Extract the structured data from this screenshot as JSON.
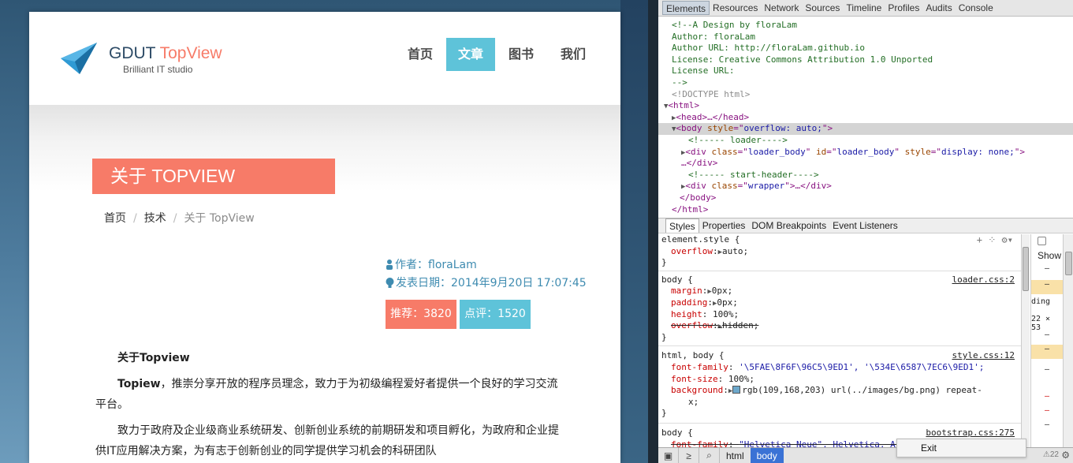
{
  "site": {
    "brand_main": "GDUT",
    "brand_accent": "TopView",
    "tagline": "Brilliant IT studio",
    "nav": [
      {
        "label": "首页",
        "active": false
      },
      {
        "label": "文章",
        "active": true
      },
      {
        "label": "图书",
        "active": false
      },
      {
        "label": "我们",
        "active": false
      }
    ],
    "title": "关于 TOPVIEW",
    "breadcrumb": [
      "首页",
      "技术",
      "关于 TopView"
    ],
    "author": "作者：floraLam",
    "date": "发表日期：2014年9月20日 17:07:45",
    "recommend": "推荐：3820",
    "comments": "点评：1520",
    "article": {
      "heading": "关于Topview",
      "p1_bold": "Topiew",
      "p1_text": "，推崇分享开放的程序员理念，致力于为初级编程爱好者提供一个良好的学习交流平台。",
      "p2_text": "致力于政府及企业级商业系统研发、创新创业系统的前期研发和项目孵化，为政府和企业提供IT应用解决方案，为有志于创新创业的同学提供学习机会的科研团队"
    },
    "colors": {
      "accent_red": "#f77b68",
      "accent_blue": "#5ec3d9",
      "navy": "#2d4b66",
      "link_blue": "#3e8bb0"
    }
  },
  "devtools": {
    "tabs": [
      "Elements",
      "Resources",
      "Network",
      "Sources",
      "Timeline",
      "Profiles",
      "Audits",
      "Console"
    ],
    "active_tab": "Elements",
    "comment_lines": [
      "<!--A Design by floraLam",
      "Author: floraLam",
      "Author URL: http://floraLam.github.io",
      "License: Creative Commons Attribution 1.0 Unported",
      "License URL:",
      "-->"
    ],
    "doctype": "<!DOCTYPE html>",
    "html_open": "<html>",
    "head": "<head>…</head>",
    "body_tag": "body",
    "body_attr": "style",
    "body_attr_val": "overflow: auto;",
    "loader_comment": "<!----- loader---->",
    "loader_div_class": "loader_body",
    "loader_div_id": "loader_body",
    "loader_div_style": "display: none;",
    "loader_div_close": "…</div>",
    "header_comment": "<!----- start-header---->",
    "wrapper_class": "wrapper",
    "wrapper_tail": "…</div>",
    "body_close": "</body>",
    "html_close": "</html>",
    "sub_tabs": [
      "Styles",
      "Properties",
      "DOM Breakpoints",
      "Event Listeners"
    ],
    "rules": {
      "element_style": {
        "selector": "element.style {",
        "prop": "overflow",
        "value": "auto;"
      },
      "body_loader": {
        "selector": "body {",
        "source": "loader.css:2",
        "props": [
          {
            "name": "margin",
            "value": "0px;"
          },
          {
            "name": "padding",
            "value": "0px;"
          },
          {
            "name": "height",
            "value": "100%;"
          },
          {
            "name": "overflow",
            "value": "hidden;"
          }
        ]
      },
      "html_body_style": {
        "selector": "html, body {",
        "source": "style.css:12",
        "font_family": "'\\5FAE\\8F6F\\96C5\\9ED1', '\\534E\\6587\\7EC6\\9ED1';",
        "font_size": "100%;",
        "background_val": "rgb(109,168,203) url(../images/bg.png) repeat-",
        "background_tail": "x;"
      },
      "body_bootstrap": {
        "selector": "body {",
        "source": "bootstrap.css:275",
        "font_family": "\"Helvetica Neue\", Helvetica, Arial, sans-serif;"
      }
    },
    "metrics": {
      "show_label": "Show",
      "padding_label": "ding",
      "dims": "22 × 53",
      "dash": "–"
    },
    "bottom": {
      "crumbs": [
        "html",
        "body"
      ],
      "active_crumb": "body",
      "exit": "Exit",
      "warn": "⚠22"
    }
  }
}
